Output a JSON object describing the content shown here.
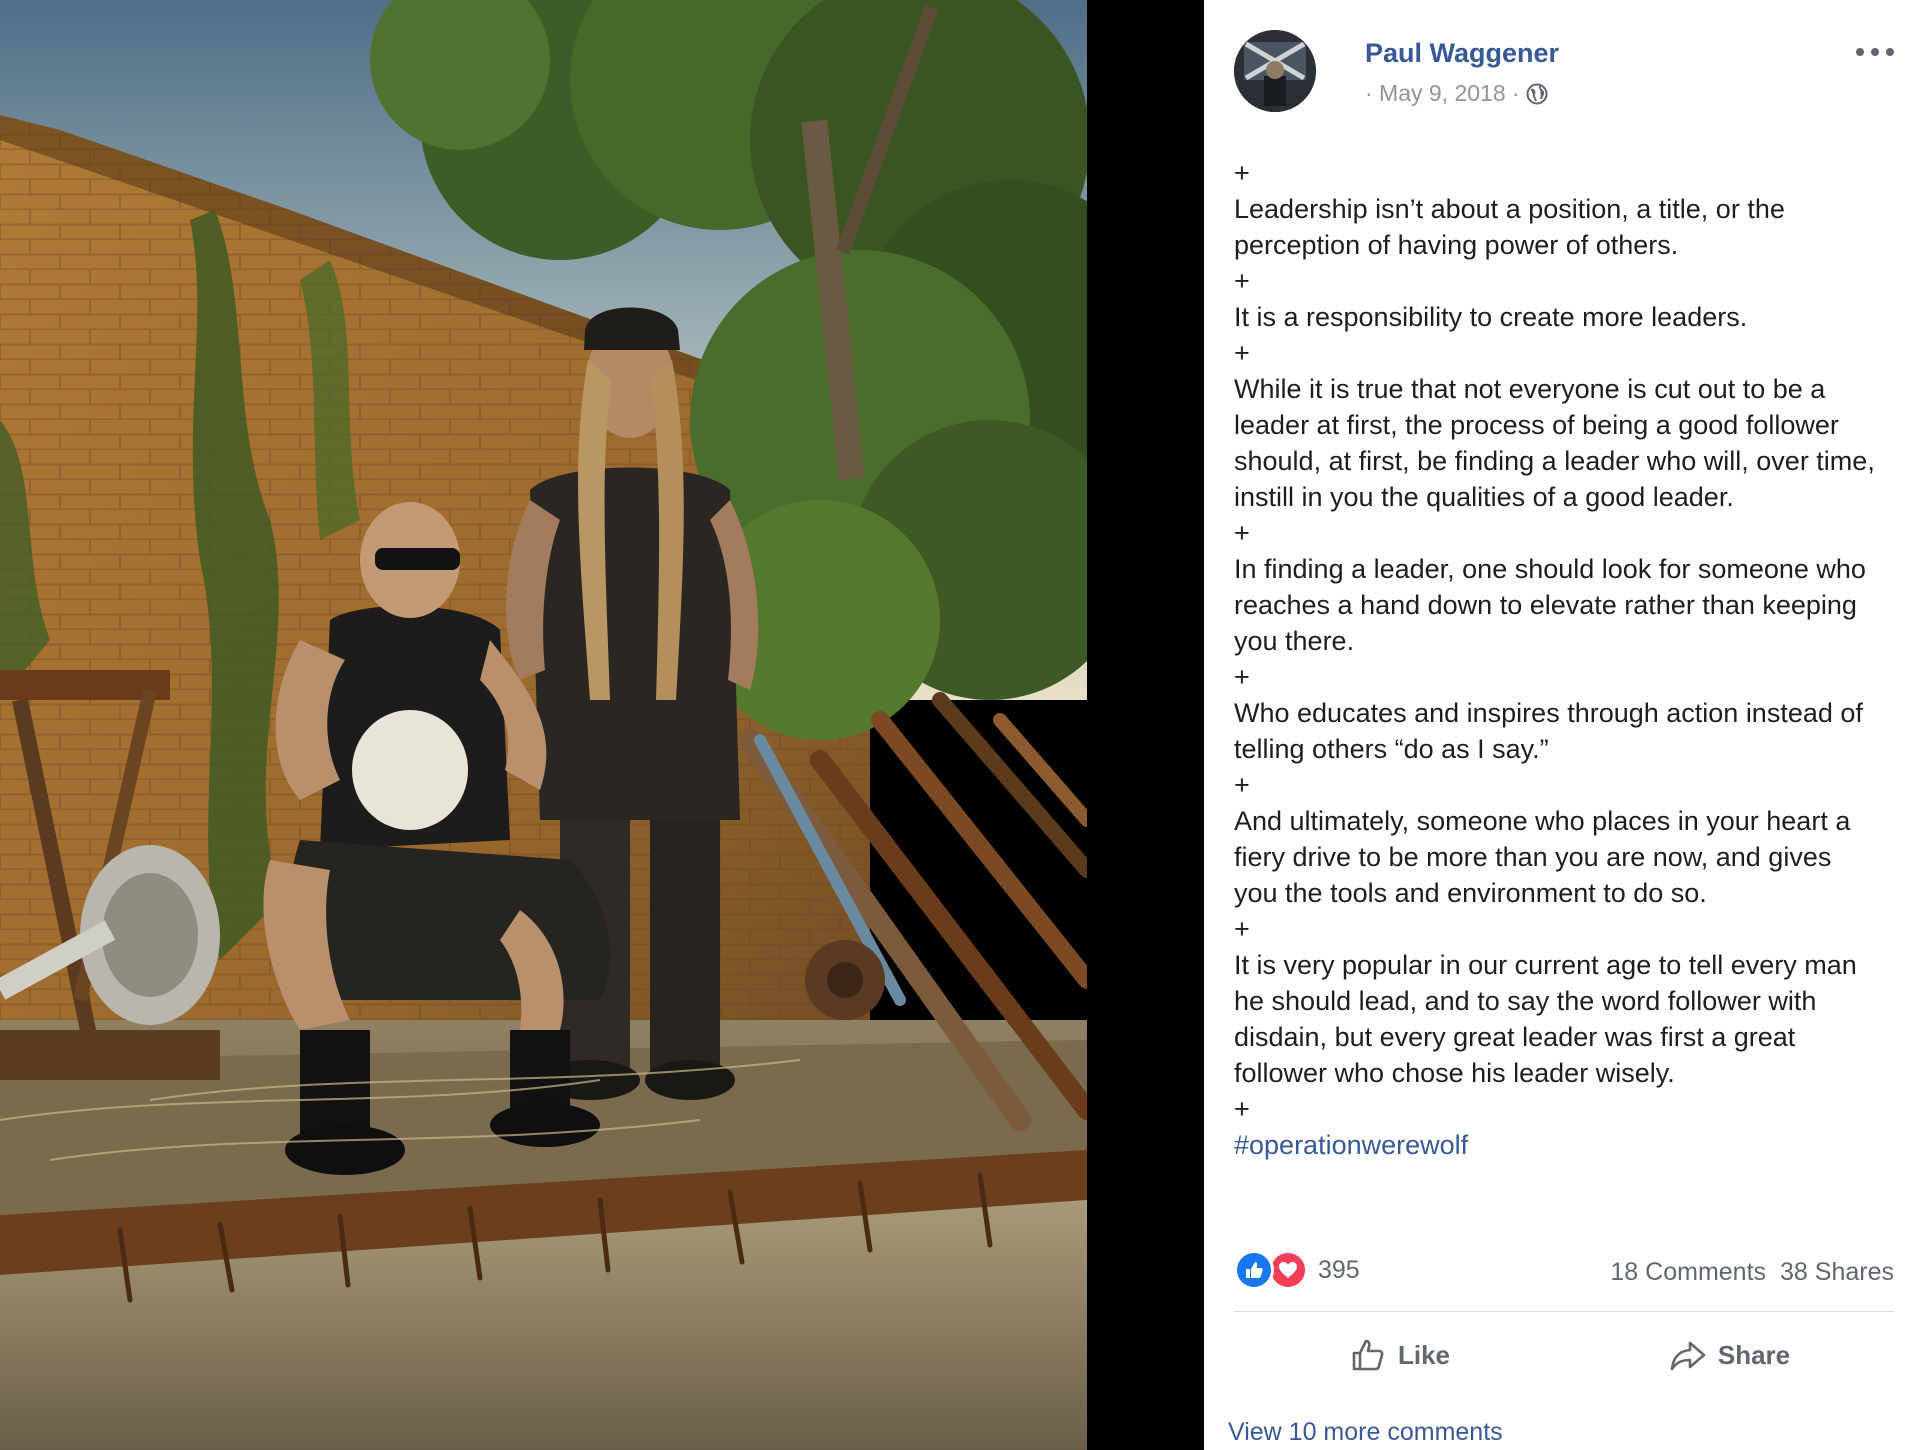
{
  "post": {
    "author": "Paul Waggener",
    "date": "· May 9, 2018 ·",
    "text_lines": [
      "+",
      "Leadership isn’t about a position, a title, or the",
      "perception of having power of others.",
      "+",
      "It is a responsibility to create more leaders.",
      "+",
      "While it is true that not everyone is cut out to be a",
      "leader at first, the process of being a good follower",
      "should, at first, be finding a leader who will, over time,",
      "instill in you the qualities of a good leader.",
      "+",
      "In finding a leader, one should look for someone who",
      "reaches a hand down to elevate rather than keeping",
      "you there.",
      "+",
      "Who educates and inspires through action instead of",
      "telling others “do as I say.”",
      "+",
      "And ultimately, someone who places in your heart a",
      "fiery drive to be more than you are now, and gives",
      "you the tools and environment to do so.",
      "+",
      "It is very popular in our current age to tell every man",
      "he should lead, and to say the word follower with",
      "disdain, but every great leader was first a great",
      "follower who chose his leader wisely.",
      "+"
    ],
    "hashtag": "#operationwerewolf"
  },
  "stats": {
    "reaction_count": "395",
    "comments": "18 Comments",
    "shares": "38 Shares"
  },
  "actions": {
    "like_label": "Like",
    "share_label": "Share"
  },
  "comments": {
    "more_link": "View 10 more comments"
  },
  "icons": {
    "globe": "globe-icon",
    "more": "more-options-icon",
    "like_reaction": "thumbs-up-icon",
    "love_reaction": "heart-icon",
    "like_action": "thumbs-up-outline-icon",
    "share_action": "share-arrow-icon"
  },
  "colors": {
    "link_blue": "#385898",
    "like_blue": "#1877f2",
    "love_red": "#f33e58",
    "muted_text": "#606770",
    "meta_text": "#90949c"
  }
}
